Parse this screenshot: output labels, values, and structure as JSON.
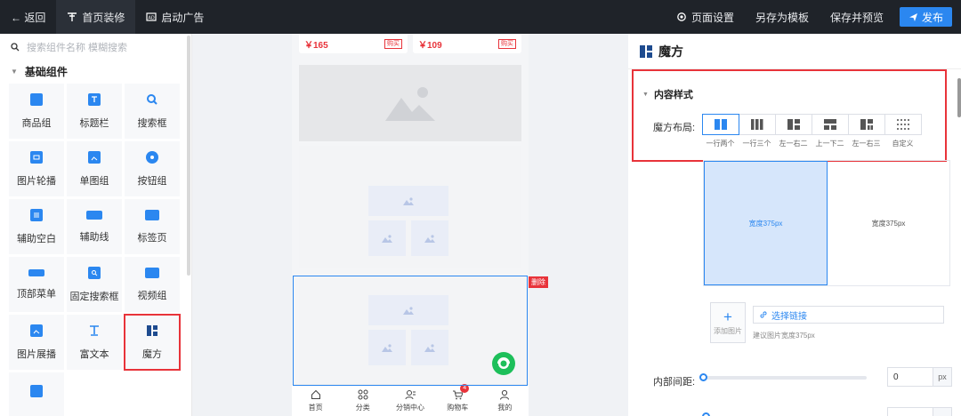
{
  "topbar": {
    "back_label": "← 返回",
    "nav": [
      {
        "label": "首页装修",
        "icon": "pin-icon",
        "active": true
      },
      {
        "label": "启动广告",
        "icon": "ad-icon",
        "active": false
      }
    ],
    "page_settings": "页面设置",
    "save_template": "另存为模板",
    "save_preview": "保存并预览",
    "publish": "发布"
  },
  "left": {
    "search_placeholder": "搜索组件名称 模糊搜索",
    "group_title": "基础组件",
    "components": [
      {
        "label": "商品组",
        "icon": "goods-group-icon"
      },
      {
        "label": "标题栏",
        "icon": "title-bar-icon"
      },
      {
        "label": "搜索框",
        "icon": "search-box-icon"
      },
      {
        "label": "图片轮播",
        "icon": "carousel-icon"
      },
      {
        "label": "单图组",
        "icon": "single-image-icon"
      },
      {
        "label": "按钮组",
        "icon": "button-group-icon"
      },
      {
        "label": "辅助空白",
        "icon": "blank-space-icon"
      },
      {
        "label": "辅助线",
        "icon": "divider-line-icon"
      },
      {
        "label": "标签页",
        "icon": "tabs-icon"
      },
      {
        "label": "顶部菜单",
        "icon": "top-menu-icon"
      },
      {
        "label": "固定搜索框",
        "icon": "fixed-search-icon"
      },
      {
        "label": "视频组",
        "icon": "video-group-icon"
      },
      {
        "label": "图片展播",
        "icon": "image-showcase-icon"
      },
      {
        "label": "富文本",
        "icon": "rich-text-icon"
      },
      {
        "label": "魔方",
        "icon": "magic-cube-icon"
      },
      {
        "label": "",
        "icon": "more-component-icon"
      }
    ]
  },
  "canvas": {
    "products": [
      {
        "price": "￥165",
        "buy": "购买"
      },
      {
        "price": "￥109",
        "buy": "购买"
      }
    ],
    "delete_label": "删除",
    "tabbar": [
      {
        "label": "首页",
        "icon": "home-icon"
      },
      {
        "label": "分类",
        "icon": "category-icon"
      },
      {
        "label": "分销中心",
        "icon": "distribution-icon"
      },
      {
        "label": "购物车",
        "icon": "cart-icon",
        "badge": "4"
      },
      {
        "label": "我的",
        "icon": "user-icon"
      }
    ]
  },
  "right": {
    "title": "魔方",
    "section_title": "内容样式",
    "layout_label": "魔方布局:",
    "layout_options": [
      {
        "label": "一行两个",
        "active": true
      },
      {
        "label": "一行三个",
        "active": false
      },
      {
        "label": "左一右二",
        "active": false
      },
      {
        "label": "上一下二",
        "active": false
      },
      {
        "label": "左一右三",
        "active": false
      },
      {
        "label": "自定义",
        "active": false
      }
    ],
    "preview_left": "宽度375px",
    "preview_right": "宽度375px",
    "add_image": "添加图片",
    "select_link": "选择链接",
    "hint": "建议图片宽度375px",
    "spacing_label": "内部间距:",
    "spacing_value": "0",
    "spacing_unit": "px"
  },
  "colors": {
    "accent": "#2b87f0",
    "danger": "#e8333a",
    "topbar": "#1f2329"
  }
}
